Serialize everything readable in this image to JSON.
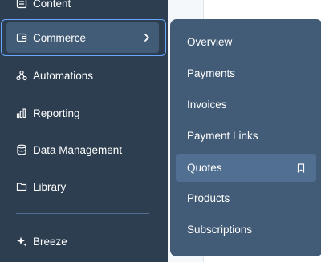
{
  "sidebar": {
    "items": [
      {
        "label": "Content",
        "icon": "content-icon"
      },
      {
        "label": "Commerce",
        "icon": "commerce-icon"
      },
      {
        "label": "Automations",
        "icon": "automations-icon"
      },
      {
        "label": "Reporting",
        "icon": "reporting-icon"
      },
      {
        "label": "Data Management",
        "icon": "database-icon"
      },
      {
        "label": "Library",
        "icon": "folder-icon"
      },
      {
        "label": "Breeze",
        "icon": "sparkle-icon"
      }
    ]
  },
  "flyout": {
    "items": [
      {
        "label": "Overview"
      },
      {
        "label": "Payments"
      },
      {
        "label": "Invoices"
      },
      {
        "label": "Payment Links"
      },
      {
        "label": "Quotes",
        "icon": "bookmark-icon"
      },
      {
        "label": "Products"
      },
      {
        "label": "Subscriptions"
      }
    ]
  },
  "colors": {
    "sidebar_bg": "#2d3e50",
    "active_bg": "#425b76",
    "flyout_bg": "#425b76",
    "highlight_bg": "#516f90",
    "focus_outline": "#6aa8ff"
  }
}
